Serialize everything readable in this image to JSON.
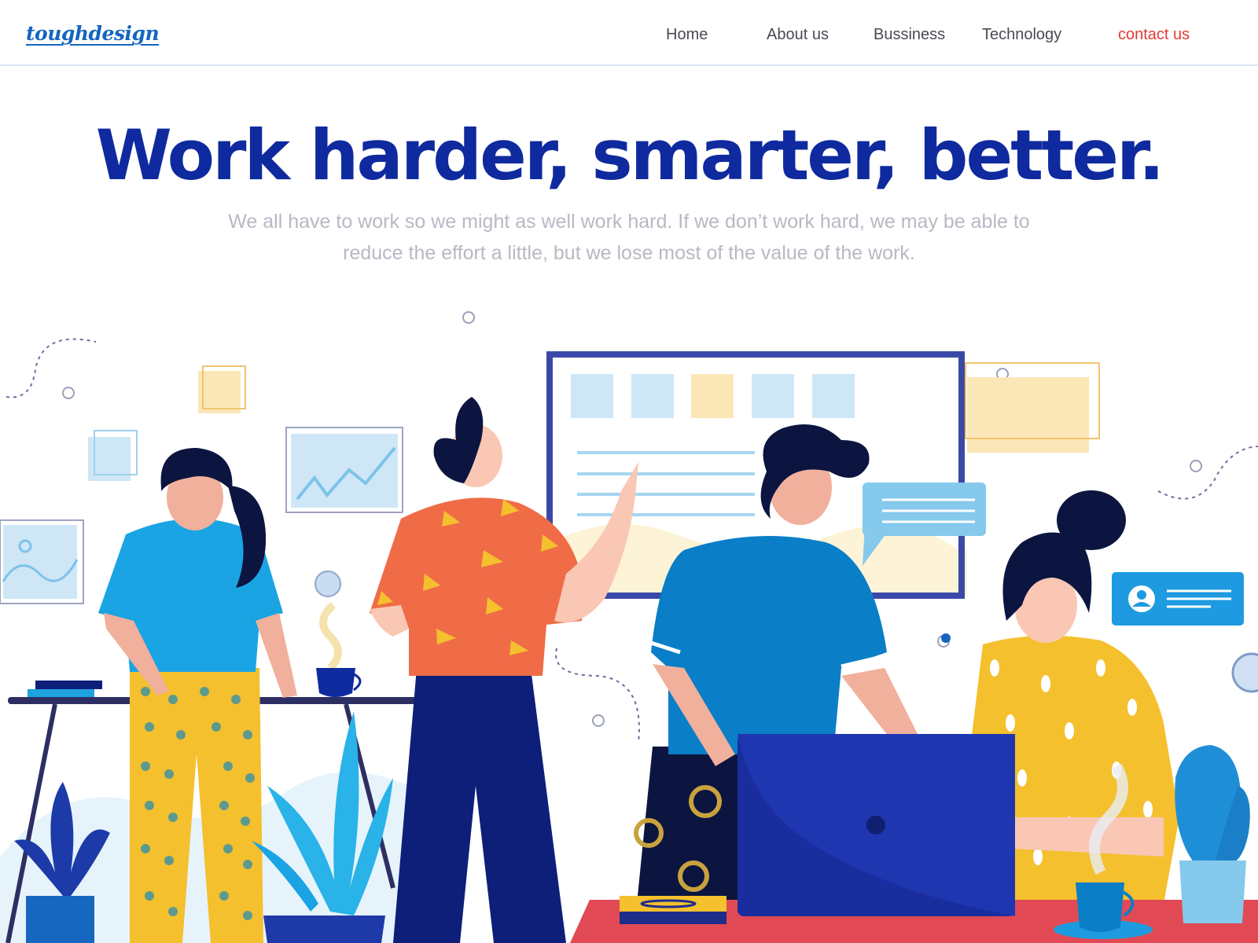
{
  "brand": {
    "logo_text": "toughdesign"
  },
  "nav": {
    "items": [
      {
        "label": "Home"
      },
      {
        "label": "About us"
      },
      {
        "label": "Bussiness"
      },
      {
        "label": "Technology"
      }
    ],
    "contact_label": "contact us"
  },
  "hero": {
    "title": "Work harder, smarter, better.",
    "subtitle_line1": "We all have to work so we might as well work hard. If we don’t work hard, we may be able to",
    "subtitle_line2": "reduce the effort a little, but we lose most of the value of the work."
  },
  "colors": {
    "title": "#0f2a9e",
    "accent_red": "#e53935",
    "brand_blue": "#1565c0",
    "subtitle_gray": "#b7b9c3"
  }
}
